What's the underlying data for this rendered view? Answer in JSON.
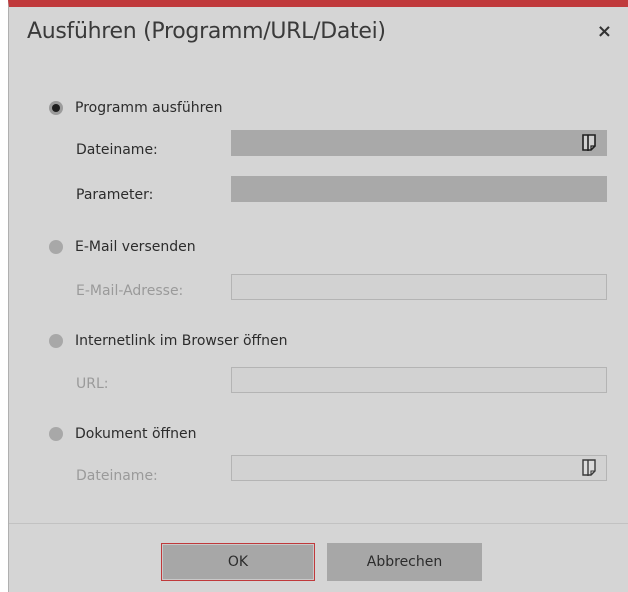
{
  "dialog": {
    "title": "Ausführen (Programm/URL/Datei)",
    "close_glyph": "×"
  },
  "options": {
    "program": {
      "label": "Programm ausführen",
      "selected": true,
      "filename_label": "Dateiname:",
      "filename_value": "",
      "parameter_label": "Parameter:",
      "parameter_value": ""
    },
    "email": {
      "label": "E-Mail versenden",
      "selected": false,
      "address_label": "E-Mail-Adresse:",
      "address_value": ""
    },
    "weblink": {
      "label": "Internetlink im Browser öffnen",
      "selected": false,
      "url_label": "URL:",
      "url_value": ""
    },
    "document": {
      "label": "Dokument öffnen",
      "selected": false,
      "filename_label": "Dateiname:",
      "filename_value": ""
    }
  },
  "buttons": {
    "ok": "OK",
    "cancel": "Abbrechen"
  },
  "colors": {
    "accent": "#c0393b",
    "dialog_bg": "#d5d5d5"
  },
  "icons": {
    "browse": "folder-open-icon",
    "close": "close-icon"
  }
}
